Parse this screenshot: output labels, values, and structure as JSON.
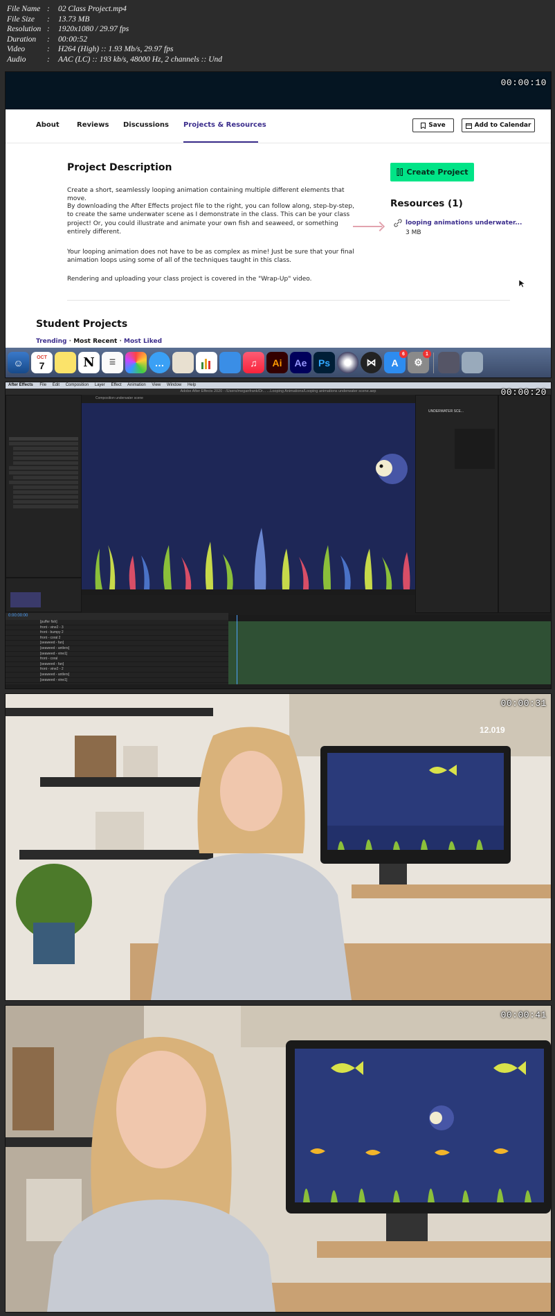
{
  "file_info": [
    {
      "key": "File Name",
      "value": "02 Class Project.mp4"
    },
    {
      "key": "File Size",
      "value": "13.73 MB"
    },
    {
      "key": "Resolution",
      "value": "1920x1080 / 29.97 fps"
    },
    {
      "key": "Duration",
      "value": "00:00:52"
    },
    {
      "key": "Video",
      "value": "H264 (High) :: 1.93 Mb/s, 29.97 fps"
    },
    {
      "key": "Audio",
      "value": "AAC (LC) :: 193 kb/s, 48000 Hz, 2 channels :: Und"
    }
  ],
  "frames": {
    "f1_time": "00:00:10",
    "f2_time": "00:00:20",
    "f3_time": "00:00:31",
    "f4_time": "00:00:41"
  },
  "page": {
    "tabs": [
      "About",
      "Reviews",
      "Discussions",
      "Projects & Resources"
    ],
    "save_label": "Save",
    "calendar_label": "Add to Calendar",
    "project_title": "Project Description",
    "paragraphs": [
      "Create a short, seamlessly looping animation containing multiple different elements that move.",
      "By downloading the After Effects project file to the right, you can follow along, step-by-step, to create the same underwater scene as I demonstrate in the class. This can be your class project! Or, you could illustrate and animate your own fish and seaweed, or something entirely different.",
      "Your looping animation does not have to be as complex as mine! Just be sure that your final animation loops using some of all of the techniques taught in this class.",
      "Rendering and uploading your class project is covered in the \"Wrap-Up\" video."
    ],
    "create_label": "Create Project",
    "resources_title": "Resources (1)",
    "resource_link": "looping animations underwater...",
    "resource_size": "3 MB",
    "student_projects": "Student Projects",
    "filters": [
      "Trending",
      "Most Recent",
      "Most Liked"
    ]
  },
  "dock": {
    "calendar_month": "OCT",
    "calendar_day": "7",
    "labels": [
      "Ai",
      "Ae",
      "Ps"
    ],
    "mail_badge": "6",
    "settings_badge": "1"
  },
  "ae": {
    "menu": [
      "After Effects",
      "File",
      "Edit",
      "Composition",
      "Layer",
      "Effect",
      "Animation",
      "View",
      "Window",
      "Help"
    ],
    "title": "Adobe After Effects 2020 - /Users/meganfrank/Dr... ...Looping Animations/Looping animations underwater scene.aep",
    "comp_tab": "Composition underwater scene",
    "current_time": "0:00:00:00",
    "layers": [
      "[puffer fish]",
      "front - vine2 - 3",
      "front - bumpy 2",
      "front - coral 2",
      "[seaweed - fan]",
      "[seaweed - antlers]",
      "[seaweed - vine1]",
      "front - coral",
      "[seaweed - fan]",
      "front - vine2 - 2",
      "[seaweed - antlers]",
      "[seaweed - vine1]"
    ],
    "mode": "None",
    "panel_title": "UNDERWATER SCE..."
  },
  "desk": {
    "calendar_year": "12.019"
  },
  "colors": {
    "purple": "#3b2d8c",
    "green": "#00e487",
    "navy": "#051522",
    "ocean": "#24306a"
  }
}
